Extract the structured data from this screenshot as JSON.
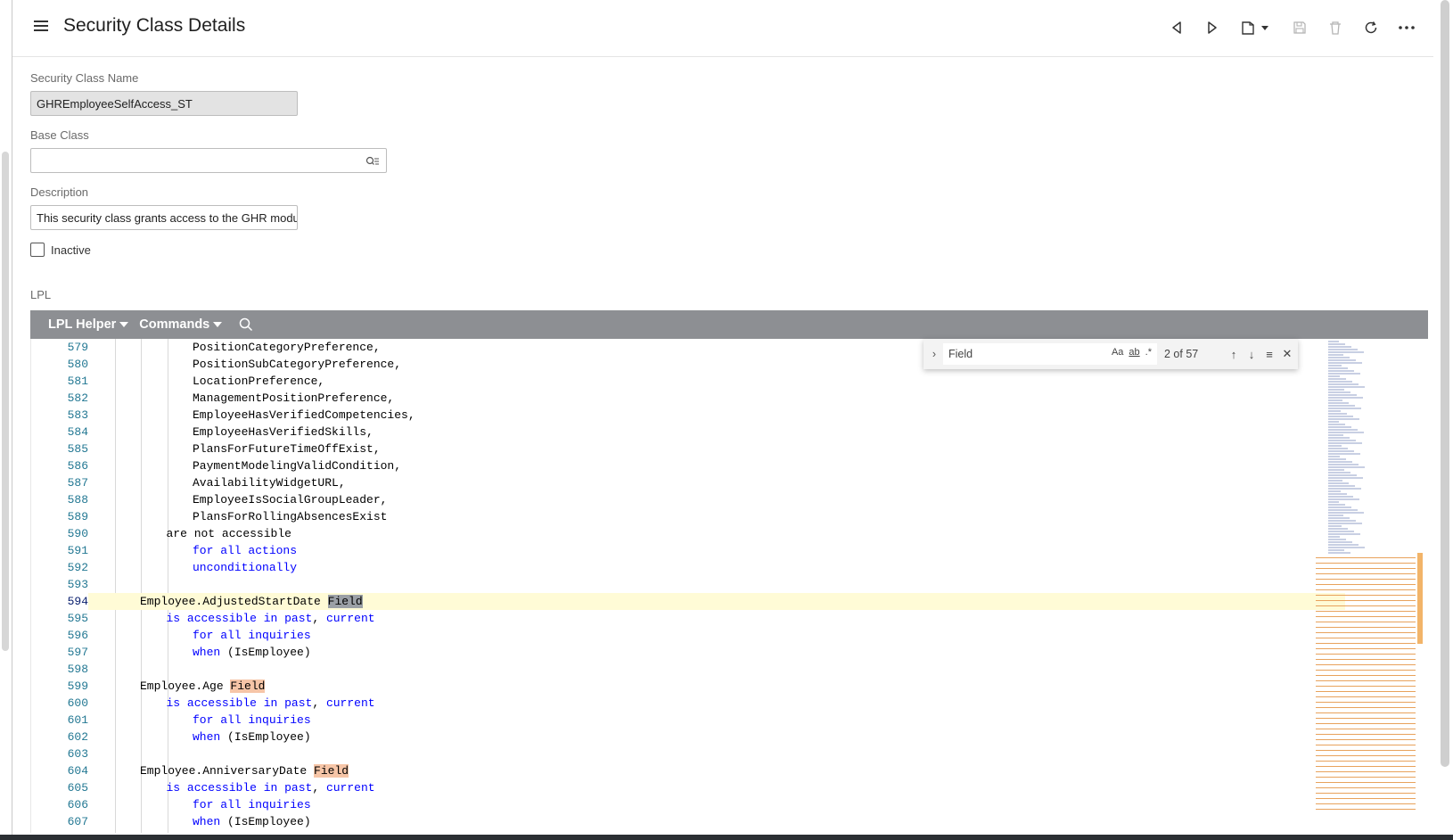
{
  "header": {
    "title": "Security Class Details",
    "toolbar": [
      {
        "name": "previous-record-button",
        "icon": "triangle-left-icon",
        "disabled": false
      },
      {
        "name": "next-record-button",
        "icon": "triangle-right-icon",
        "disabled": false
      },
      {
        "name": "new-record-button",
        "icon": "new-document-icon",
        "disabled": false
      },
      {
        "name": "save-button",
        "icon": "save-icon",
        "disabled": true
      },
      {
        "name": "delete-button",
        "icon": "trash-icon",
        "disabled": true
      },
      {
        "name": "refresh-button",
        "icon": "refresh-icon",
        "disabled": false
      },
      {
        "name": "more-actions-button",
        "icon": "more-horizontal-icon",
        "disabled": false
      }
    ]
  },
  "form": {
    "security_class_name": {
      "label": "Security Class Name",
      "value": "GHREmployeeSelfAccess_ST"
    },
    "base_class": {
      "label": "Base Class",
      "value": ""
    },
    "description": {
      "label": "Description",
      "value": "This security class grants access to the GHR modu"
    },
    "inactive": {
      "label": "Inactive",
      "checked": false
    },
    "lpl_label": "LPL"
  },
  "lpl_toolbar": {
    "helper_label": "LPL Helper",
    "commands_label": "Commands"
  },
  "find_widget": {
    "query": "Field",
    "match_case": "Aa",
    "whole_word": "ab",
    "regex": ".*",
    "count": "2 of 57"
  },
  "editor": {
    "active_line": 594,
    "lines": [
      {
        "n": "579",
        "indent": 3,
        "tokens": [
          {
            "t": "PositionCategoryPreference,",
            "c": ""
          }
        ]
      },
      {
        "n": "580",
        "indent": 3,
        "tokens": [
          {
            "t": "PositionSubCategoryPreference,",
            "c": ""
          }
        ]
      },
      {
        "n": "581",
        "indent": 3,
        "tokens": [
          {
            "t": "LocationPreference,",
            "c": ""
          }
        ]
      },
      {
        "n": "582",
        "indent": 3,
        "tokens": [
          {
            "t": "ManagementPositionPreference,",
            "c": ""
          }
        ]
      },
      {
        "n": "583",
        "indent": 3,
        "tokens": [
          {
            "t": "EmployeeHasVerifiedCompetencies,",
            "c": ""
          }
        ]
      },
      {
        "n": "584",
        "indent": 3,
        "tokens": [
          {
            "t": "EmployeeHasVerifiedSkills,",
            "c": ""
          }
        ]
      },
      {
        "n": "585",
        "indent": 3,
        "tokens": [
          {
            "t": "PlansForFutureTimeOffExist,",
            "c": ""
          }
        ]
      },
      {
        "n": "586",
        "indent": 3,
        "tokens": [
          {
            "t": "PaymentModelingValidCondition,",
            "c": ""
          }
        ]
      },
      {
        "n": "587",
        "indent": 3,
        "tokens": [
          {
            "t": "AvailabilityWidgetURL,",
            "c": ""
          }
        ]
      },
      {
        "n": "588",
        "indent": 3,
        "tokens": [
          {
            "t": "EmployeeIsSocialGroupLeader,",
            "c": ""
          }
        ]
      },
      {
        "n": "589",
        "indent": 3,
        "tokens": [
          {
            "t": "PlansForRollingAbsencesExist",
            "c": ""
          }
        ]
      },
      {
        "n": "590",
        "indent": 2,
        "tokens": [
          {
            "t": "are not accessible",
            "c": ""
          }
        ]
      },
      {
        "n": "591",
        "indent": 3,
        "tokens": [
          {
            "t": "for all actions",
            "c": "kw"
          }
        ]
      },
      {
        "n": "592",
        "indent": 3,
        "tokens": [
          {
            "t": "unconditionally",
            "c": "kw"
          }
        ]
      },
      {
        "n": "593",
        "indent": 0,
        "tokens": []
      },
      {
        "n": "594",
        "indent": 1,
        "tokens": [
          {
            "t": "Employee.AdjustedStartDate ",
            "c": ""
          },
          {
            "t": "Field",
            "c": "m-cur"
          }
        ]
      },
      {
        "n": "595",
        "indent": 2,
        "tokens": [
          {
            "t": "is accessible in past",
            "c": "kw"
          },
          {
            "t": ", ",
            "c": ""
          },
          {
            "t": "current",
            "c": "kw"
          }
        ]
      },
      {
        "n": "596",
        "indent": 3,
        "tokens": [
          {
            "t": "for all inquiries",
            "c": "kw"
          }
        ]
      },
      {
        "n": "597",
        "indent": 3,
        "tokens": [
          {
            "t": "when",
            "c": "kw"
          },
          {
            "t": " (IsEmployee)",
            "c": ""
          }
        ]
      },
      {
        "n": "598",
        "indent": 0,
        "tokens": []
      },
      {
        "n": "599",
        "indent": 1,
        "tokens": [
          {
            "t": "Employee.Age ",
            "c": ""
          },
          {
            "t": "Field",
            "c": "m-oth"
          }
        ]
      },
      {
        "n": "600",
        "indent": 2,
        "tokens": [
          {
            "t": "is accessible in past",
            "c": "kw"
          },
          {
            "t": ", ",
            "c": ""
          },
          {
            "t": "current",
            "c": "kw"
          }
        ]
      },
      {
        "n": "601",
        "indent": 3,
        "tokens": [
          {
            "t": "for all inquiries",
            "c": "kw"
          }
        ]
      },
      {
        "n": "602",
        "indent": 3,
        "tokens": [
          {
            "t": "when",
            "c": "kw"
          },
          {
            "t": " (IsEmployee)",
            "c": ""
          }
        ]
      },
      {
        "n": "603",
        "indent": 0,
        "tokens": []
      },
      {
        "n": "604",
        "indent": 1,
        "tokens": [
          {
            "t": "Employee.AnniversaryDate ",
            "c": ""
          },
          {
            "t": "Field",
            "c": "m-oth"
          }
        ]
      },
      {
        "n": "605",
        "indent": 2,
        "tokens": [
          {
            "t": "is accessible in past",
            "c": "kw"
          },
          {
            "t": ", ",
            "c": ""
          },
          {
            "t": "current",
            "c": "kw"
          }
        ]
      },
      {
        "n": "606",
        "indent": 3,
        "tokens": [
          {
            "t": "for all inquiries",
            "c": "kw"
          }
        ]
      },
      {
        "n": "607",
        "indent": 3,
        "tokens": [
          {
            "t": "when",
            "c": "kw"
          },
          {
            "t": " (IsEmployee)",
            "c": ""
          }
        ]
      }
    ]
  },
  "colors": {
    "keyword": "#0000ff",
    "line_number": "#237893",
    "current_match": "#9ba0a6",
    "other_match": "#f6c5a7",
    "active_line": "#fffbd6",
    "toolbar_bg": "#8d8f93"
  }
}
